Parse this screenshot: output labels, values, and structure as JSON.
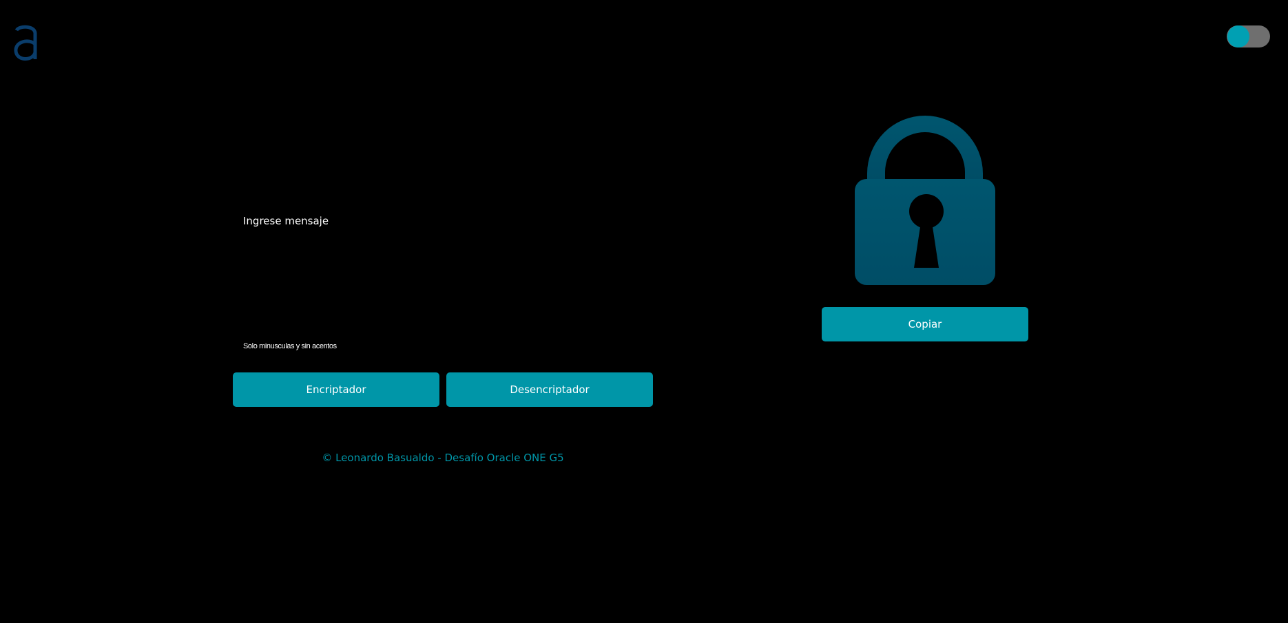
{
  "theme": {
    "background": "#000000",
    "accent": "#0096a8",
    "lock_color": "#00566f",
    "logo_color": "#0a3d6b",
    "toggle_track": "#6f6f6f"
  },
  "header": {
    "logo_icon": "alura-logo",
    "theme_toggle_icon": "toggle-switch"
  },
  "input": {
    "placeholder": "Ingrese mensaje",
    "value": ""
  },
  "hint": {
    "text": "Solo minusculas y sin acentos"
  },
  "actions": {
    "encrypt_label": "Encriptador",
    "decrypt_label": "Desencriptador",
    "copy_label": "Copiar"
  },
  "output": {
    "icon": "lock-icon"
  },
  "footer": {
    "text": "© Leonardo Basualdo - Desafío Oracle ONE G5"
  }
}
